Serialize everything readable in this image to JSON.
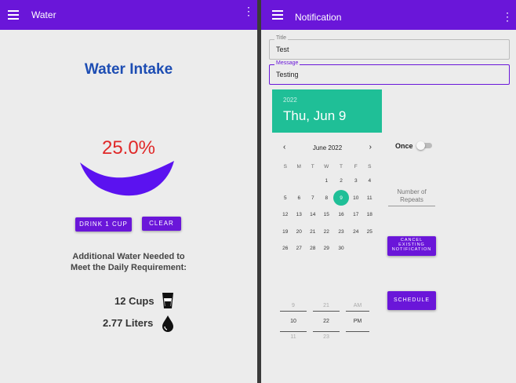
{
  "left": {
    "appbar": {
      "title": "Water"
    },
    "headline": "Water Intake",
    "percent": "25.0%",
    "fill_percent": 25,
    "buttons": {
      "drink": "DRINK 1 CUP",
      "clear": "CLEAR"
    },
    "info_line1": "Additional Water Needed to",
    "info_line2": "Meet the Daily Requirement:",
    "cups": "12 Cups",
    "liters": "2.77 Liters",
    "accent": "#6a16d9",
    "icons": [
      "menu-icon",
      "more-vert-icon",
      "water-glass-icon",
      "water-drop-icon"
    ]
  },
  "right": {
    "appbar": {
      "title": "Notification"
    },
    "title_field": {
      "label": "Title",
      "value": "Test"
    },
    "message_field": {
      "label": "Message",
      "value": "Testing"
    },
    "date_header": {
      "year": "2022",
      "date": "Thu, Jun 9"
    },
    "calendar": {
      "month": "June 2022",
      "dow": [
        "S",
        "M",
        "T",
        "W",
        "T",
        "F",
        "S"
      ],
      "leading_blanks": 3,
      "days": [
        "1",
        "2",
        "3",
        "4",
        "5",
        "6",
        "7",
        "8",
        "9",
        "10",
        "11",
        "12",
        "13",
        "14",
        "15",
        "16",
        "17",
        "18",
        "19",
        "20",
        "21",
        "22",
        "23",
        "24",
        "25",
        "26",
        "27",
        "28",
        "29",
        "30"
      ],
      "selected": "9"
    },
    "once_label": "Once",
    "repeats_placeholder_1": "Number of",
    "repeats_placeholder_2": "Repeats",
    "cancel_button": [
      "CANCEL",
      "EXISTING",
      "NOTIFICATION"
    ],
    "schedule_button": "SCHEDULE",
    "time_picker": {
      "hour": {
        "prev": "9",
        "current": "10",
        "next": "11"
      },
      "minute": {
        "prev": "21",
        "current": "22",
        "next": "23"
      },
      "ampm": {
        "prev": "AM",
        "current": "PM"
      }
    },
    "accent": "#6a16d9",
    "teal": "#1fbf97"
  }
}
